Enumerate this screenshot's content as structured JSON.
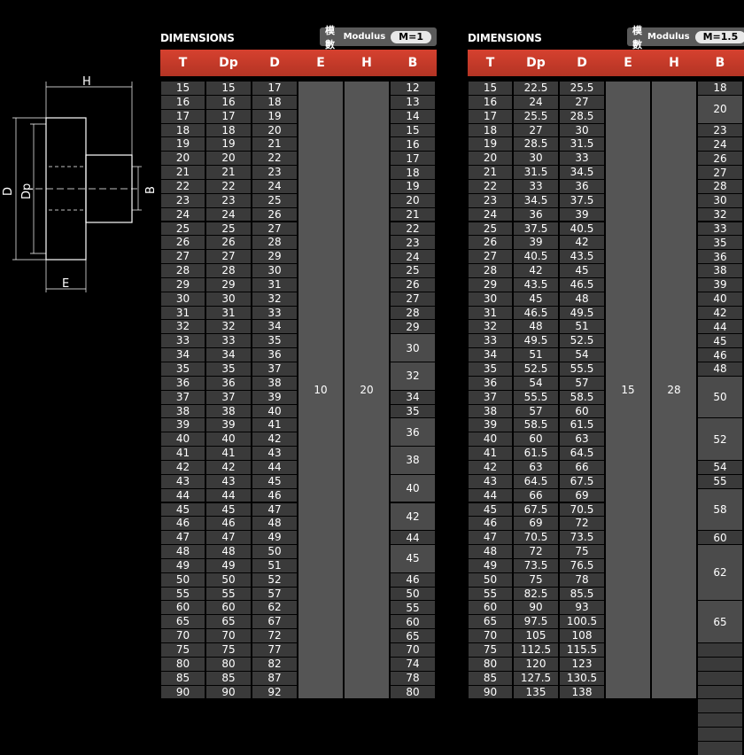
{
  "drawing": {
    "labels": {
      "H": "H",
      "D": "D",
      "Dp": "Dp",
      "B": "B",
      "E": "E"
    }
  },
  "tables": [
    {
      "title": "DIMENSIONS",
      "module_cn": "模數",
      "module_en": "Modulus",
      "module_value": "M=1",
      "headers": [
        "T",
        "Dp",
        "D",
        "E",
        "H",
        "B"
      ],
      "T": [
        "15",
        "16",
        "17",
        "18",
        "19",
        "20",
        "21",
        "22",
        "23",
        "24",
        "25",
        "26",
        "27",
        "28",
        "29",
        "30",
        "31",
        "32",
        "33",
        "34",
        "35",
        "36",
        "37",
        "38",
        "39",
        "40",
        "41",
        "42",
        "43",
        "44",
        "45",
        "46",
        "47",
        "48",
        "49",
        "50",
        "55",
        "60",
        "65",
        "70",
        "75",
        "80",
        "85",
        "90"
      ],
      "Dp": [
        "15",
        "16",
        "17",
        "18",
        "19",
        "20",
        "21",
        "22",
        "23",
        "24",
        "25",
        "26",
        "27",
        "28",
        "29",
        "30",
        "31",
        "32",
        "33",
        "34",
        "35",
        "36",
        "37",
        "38",
        "39",
        "40",
        "41",
        "42",
        "43",
        "44",
        "45",
        "46",
        "47",
        "48",
        "49",
        "50",
        "55",
        "60",
        "65",
        "70",
        "75",
        "80",
        "85",
        "90"
      ],
      "D": [
        "17",
        "18",
        "19",
        "20",
        "21",
        "22",
        "23",
        "24",
        "25",
        "26",
        "27",
        "28",
        "29",
        "30",
        "31",
        "32",
        "33",
        "34",
        "35",
        "36",
        "37",
        "38",
        "39",
        "40",
        "41",
        "42",
        "43",
        "44",
        "45",
        "46",
        "47",
        "48",
        "49",
        "50",
        "51",
        "52",
        "57",
        "62",
        "67",
        "72",
        "77",
        "82",
        "87",
        "92"
      ],
      "E": "10",
      "H": "20",
      "B": [
        {
          "v": "12",
          "span": 1
        },
        {
          "v": "13",
          "span": 1
        },
        {
          "v": "14",
          "span": 1
        },
        {
          "v": "15",
          "span": 1
        },
        {
          "v": "16",
          "span": 1
        },
        {
          "v": "17",
          "span": 1
        },
        {
          "v": "18",
          "span": 1
        },
        {
          "v": "19",
          "span": 1
        },
        {
          "v": "20",
          "span": 1
        },
        {
          "v": "21",
          "span": 1
        },
        {
          "v": "22",
          "span": 1
        },
        {
          "v": "23",
          "span": 1
        },
        {
          "v": "24",
          "span": 1
        },
        {
          "v": "25",
          "span": 1
        },
        {
          "v": "26",
          "span": 1
        },
        {
          "v": "27",
          "span": 1
        },
        {
          "v": "28",
          "span": 1
        },
        {
          "v": "29",
          "span": 1
        },
        {
          "v": "30",
          "span": 2
        },
        {
          "v": "32",
          "span": 2
        },
        {
          "v": "34",
          "span": 1
        },
        {
          "v": "35",
          "span": 1
        },
        {
          "v": "36",
          "span": 2
        },
        {
          "v": "38",
          "span": 2
        },
        {
          "v": "40",
          "span": 2
        },
        {
          "v": "42",
          "span": 2
        },
        {
          "v": "44",
          "span": 1
        },
        {
          "v": "45",
          "span": 2
        },
        {
          "v": "46",
          "span": 1
        },
        {
          "v": "50",
          "span": 1
        },
        {
          "v": "55",
          "span": 1
        },
        {
          "v": "60",
          "span": 1
        },
        {
          "v": "65",
          "span": 1
        },
        {
          "v": "70",
          "span": 1
        },
        {
          "v": "74",
          "span": 1
        },
        {
          "v": "78",
          "span": 1
        },
        {
          "v": "80",
          "span": 1
        }
      ]
    },
    {
      "title": "DIMENSIONS",
      "module_cn": "模數",
      "module_en": "Modulus",
      "module_value": "M=1.5",
      "headers": [
        "T",
        "Dp",
        "D",
        "E",
        "H",
        "B"
      ],
      "T": [
        "15",
        "16",
        "17",
        "18",
        "19",
        "20",
        "21",
        "22",
        "23",
        "24",
        "25",
        "26",
        "27",
        "28",
        "29",
        "30",
        "31",
        "32",
        "33",
        "34",
        "35",
        "36",
        "37",
        "38",
        "39",
        "40",
        "41",
        "42",
        "43",
        "44",
        "45",
        "46",
        "47",
        "48",
        "49",
        "50",
        "55",
        "60",
        "65",
        "70",
        "75",
        "80",
        "85",
        "90"
      ],
      "Dp": [
        "22.5",
        "24",
        "25.5",
        "27",
        "28.5",
        "30",
        "31.5",
        "33",
        "34.5",
        "36",
        "37.5",
        "39",
        "40.5",
        "42",
        "43.5",
        "45",
        "46.5",
        "48",
        "49.5",
        "51",
        "52.5",
        "54",
        "55.5",
        "57",
        "58.5",
        "60",
        "61.5",
        "63",
        "64.5",
        "66",
        "67.5",
        "69",
        "70.5",
        "72",
        "73.5",
        "75",
        "82.5",
        "90",
        "97.5",
        "105",
        "112.5",
        "120",
        "127.5",
        "135"
      ],
      "D": [
        "25.5",
        "27",
        "28.5",
        "30",
        "31.5",
        "33",
        "34.5",
        "36",
        "37.5",
        "39",
        "40.5",
        "42",
        "43.5",
        "45",
        "46.5",
        "48",
        "49.5",
        "51",
        "52.5",
        "54",
        "55.5",
        "57",
        "58.5",
        "60",
        "61.5",
        "63",
        "64.5",
        "66",
        "67.5",
        "69",
        "70.5",
        "72",
        "73.5",
        "75",
        "76.5",
        "78",
        "85.5",
        "93",
        "100.5",
        "108",
        "115.5",
        "123",
        "130.5",
        "138"
      ],
      "E": "15",
      "H": "28",
      "B": [
        {
          "v": "18",
          "span": 1
        },
        {
          "v": "20",
          "span": 2
        },
        {
          "v": "23",
          "span": 1
        },
        {
          "v": "24",
          "span": 1
        },
        {
          "v": "26",
          "span": 1
        },
        {
          "v": "27",
          "span": 1
        },
        {
          "v": "28",
          "span": 1
        },
        {
          "v": "30",
          "span": 1
        },
        {
          "v": "32",
          "span": 1
        },
        {
          "v": "33",
          "span": 1
        },
        {
          "v": "35",
          "span": 1
        },
        {
          "v": "36",
          "span": 1
        },
        {
          "v": "38",
          "span": 1
        },
        {
          "v": "39",
          "span": 1
        },
        {
          "v": "40",
          "span": 1
        },
        {
          "v": "42",
          "span": 1
        },
        {
          "v": "44",
          "span": 1
        },
        {
          "v": "45",
          "span": 1
        },
        {
          "v": "46",
          "span": 1
        },
        {
          "v": "48",
          "span": 1
        },
        {
          "v": "50",
          "span": 3
        },
        {
          "v": "52",
          "span": 3
        },
        {
          "v": "54",
          "span": 1
        },
        {
          "v": "55",
          "span": 1
        },
        {
          "v": "58",
          "span": 3
        },
        {
          "v": "60",
          "span": 1
        },
        {
          "v": "62",
          "span": 4
        },
        {
          "v": "65",
          "span": 3
        },
        {
          "v": "",
          "span": 1
        },
        {
          "v": "",
          "span": 1
        },
        {
          "v": "",
          "span": 1
        },
        {
          "v": "",
          "span": 1
        },
        {
          "v": "",
          "span": 1
        },
        {
          "v": "",
          "span": 1
        },
        {
          "v": "",
          "span": 1
        },
        {
          "v": "",
          "span": 1
        }
      ]
    }
  ]
}
